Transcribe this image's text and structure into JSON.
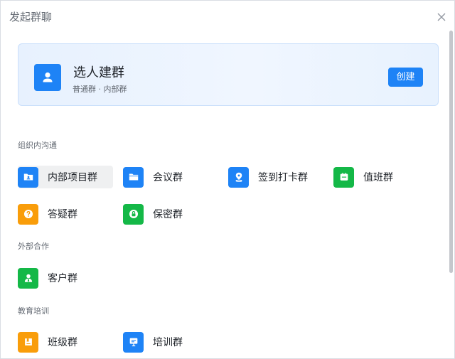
{
  "dialog": {
    "title": "发起群聊"
  },
  "hero": {
    "title": "选人建群",
    "subtitle": "普通群 · 内部群",
    "create_label": "创建",
    "icon": "person-icon"
  },
  "colors": {
    "blue": "#1e83f6",
    "green": "#14b847",
    "orange": "#f99d0a",
    "hero_background": "#e7f1fe"
  },
  "sections": [
    {
      "label": "组织内沟通",
      "items": [
        {
          "label": "内部项目群",
          "icon": "folder-person-icon",
          "color": "blue",
          "active": true
        },
        {
          "label": "会议群",
          "icon": "folder-icon",
          "color": "blue"
        },
        {
          "label": "签到打卡群",
          "icon": "location-pin-icon",
          "color": "blue"
        },
        {
          "label": "值班群",
          "icon": "briefcase-icon",
          "color": "green"
        },
        {
          "label": "答疑群",
          "icon": "question-icon",
          "color": "orange"
        },
        {
          "label": "保密群",
          "icon": "lock-icon",
          "color": "green"
        }
      ]
    },
    {
      "label": "外部合作",
      "items": [
        {
          "label": "客户群",
          "icon": "customer-icon",
          "color": "green"
        }
      ]
    },
    {
      "label": "教育培训",
      "items": [
        {
          "label": "班级群",
          "icon": "book-icon",
          "color": "orange"
        },
        {
          "label": "培训群",
          "icon": "presentation-icon",
          "color": "blue"
        }
      ]
    }
  ]
}
